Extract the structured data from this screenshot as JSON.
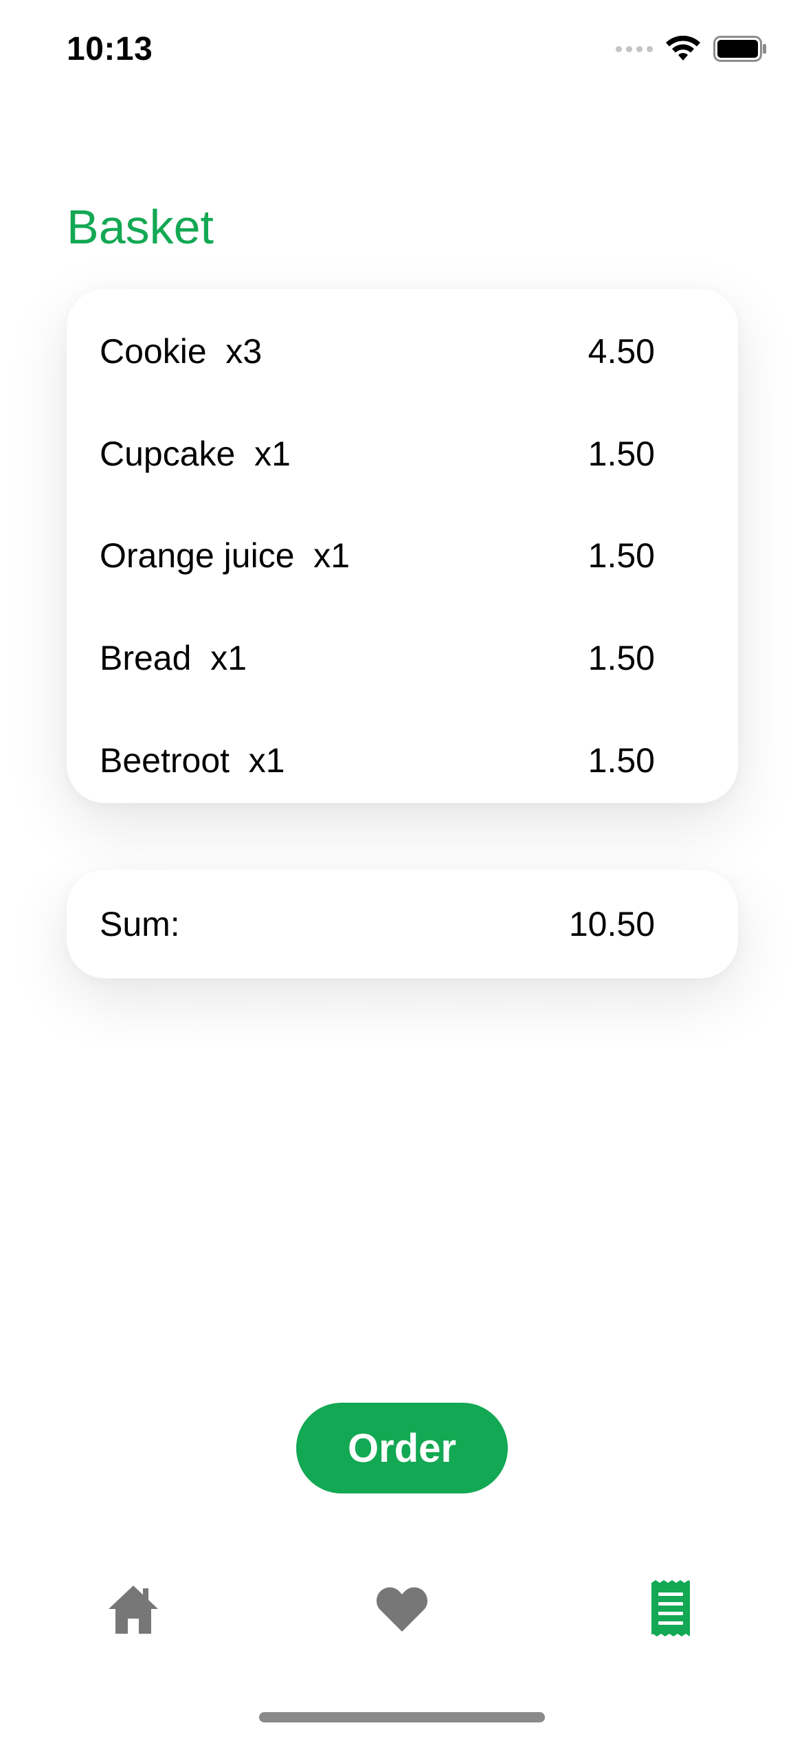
{
  "status_bar": {
    "time": "10:13"
  },
  "page": {
    "title": "Basket"
  },
  "basket": {
    "items": [
      {
        "name": "Cookie  x3",
        "price": "4.50"
      },
      {
        "name": "Cupcake  x1",
        "price": "1.50"
      },
      {
        "name": "Orange juice  x1",
        "price": "1.50"
      },
      {
        "name": "Bread  x1",
        "price": "1.50"
      },
      {
        "name": "Beetroot  x1",
        "price": "1.50"
      }
    ],
    "sum_label": "Sum:",
    "sum_value": "10.50"
  },
  "actions": {
    "order_label": "Order"
  },
  "tab_bar": {
    "tabs": [
      {
        "icon": "home-icon",
        "active": false
      },
      {
        "icon": "heart-icon",
        "active": false
      },
      {
        "icon": "receipt-icon",
        "active": true
      }
    ]
  },
  "colors": {
    "accent": "#13a853",
    "inactive_icon": "#777777",
    "background": "#ffffff"
  }
}
